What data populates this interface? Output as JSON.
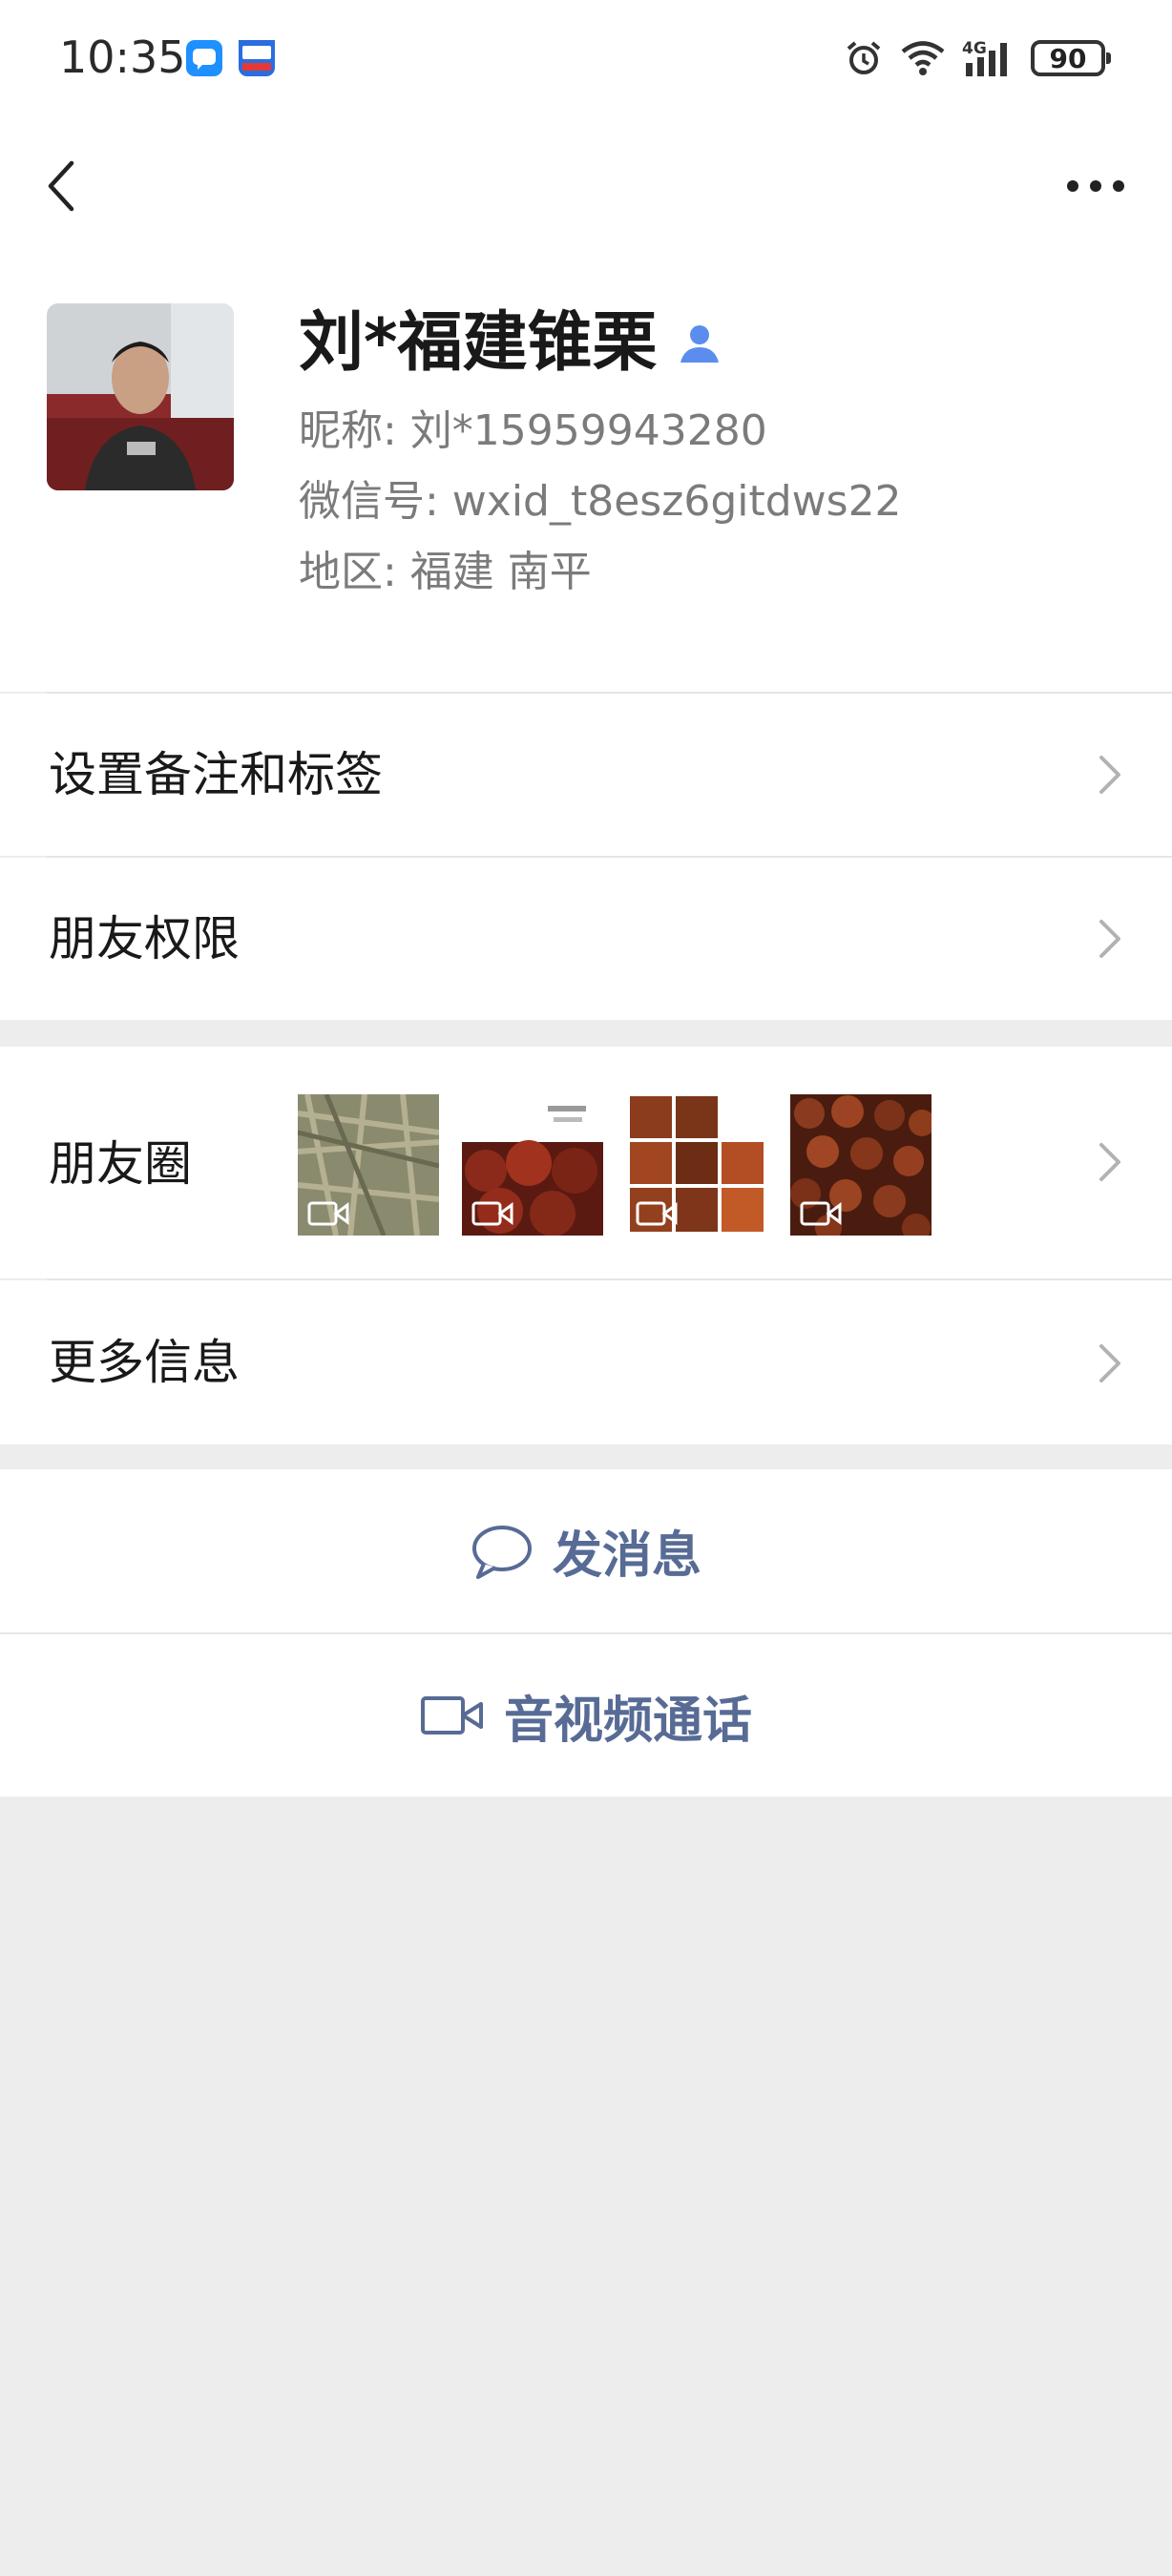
{
  "status_bar": {
    "time": "10:35",
    "network": "4G",
    "battery": "90"
  },
  "profile": {
    "display_name": "刘*福建锥栗",
    "nickname_line": "昵称:  刘*15959943280",
    "wechat_id_line": "微信号:  wxid_t8esz6gitdws22",
    "region_line": "地区:  福建  南平"
  },
  "menu": {
    "remark_tags": "设置备注和标签",
    "friend_permissions": "朋友权限",
    "moments": "朋友圈",
    "more_info": "更多信息"
  },
  "actions": {
    "send_message": "发消息",
    "av_call": "音视频通话"
  },
  "colors": {
    "accent_link": "#576b95",
    "background": "#ededed"
  }
}
